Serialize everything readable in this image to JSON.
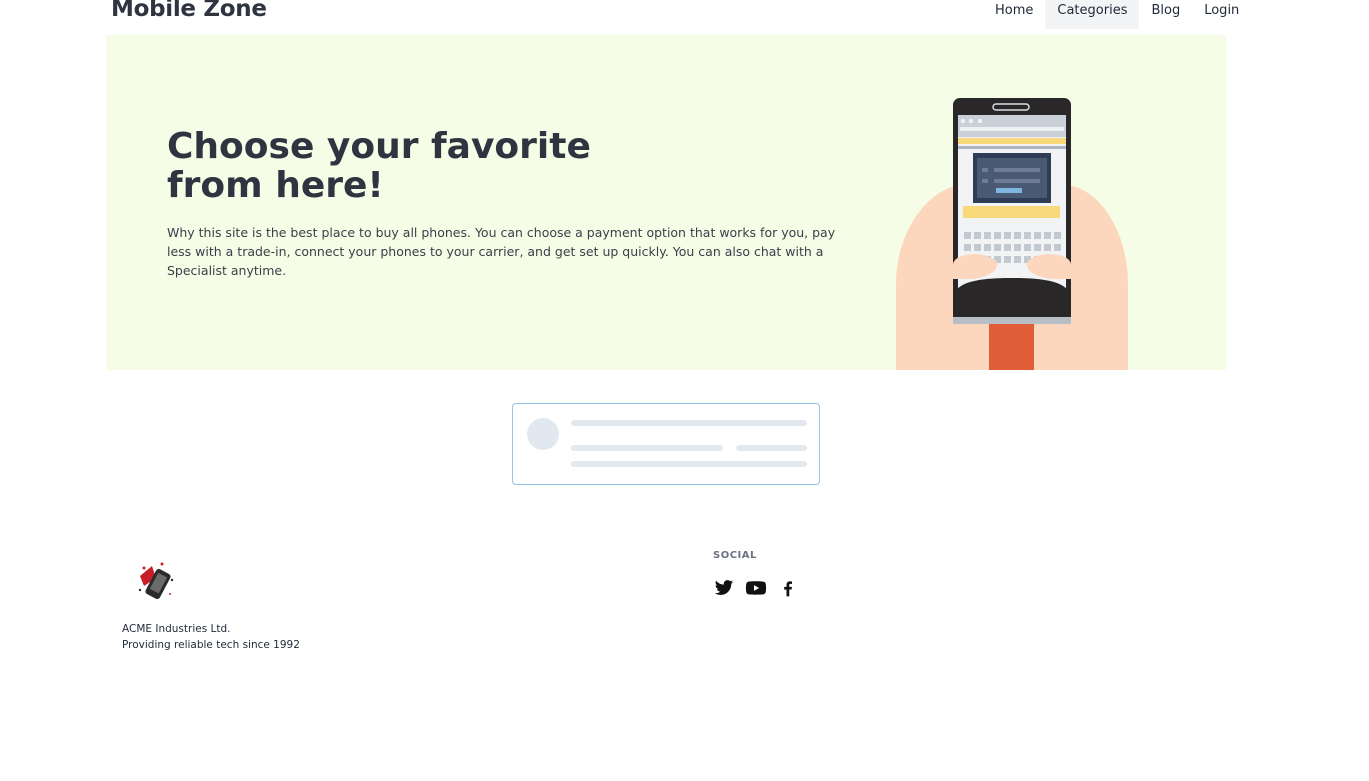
{
  "header": {
    "brand": "Mobile Zone",
    "nav": [
      {
        "label": "Home"
      },
      {
        "label": "Categories",
        "active": true
      },
      {
        "label": "Blog"
      },
      {
        "label": "Login"
      }
    ]
  },
  "hero": {
    "title_line1": "Choose your favorite",
    "title_line2": "from here!",
    "description": "Why this site is the best place to buy all phones. You can choose a payment option that works for you, pay less with a trade-in, connect your phones to your carrier, and get set up quickly. You can also chat with a Specialist anytime.",
    "background": "#f6fde7",
    "illustration": "hands-holding-phone-illustration"
  },
  "loading_placeholder": {
    "state": "loading",
    "accent": "#93c5e8"
  },
  "footer": {
    "company_name": "ACME Industries Ltd.",
    "tagline": "Providing reliable tech since 1992",
    "logo": "phone-logo-icon",
    "social_heading": "SOCIAL",
    "social_links": [
      "twitter-icon",
      "youtube-icon",
      "facebook-icon"
    ]
  }
}
